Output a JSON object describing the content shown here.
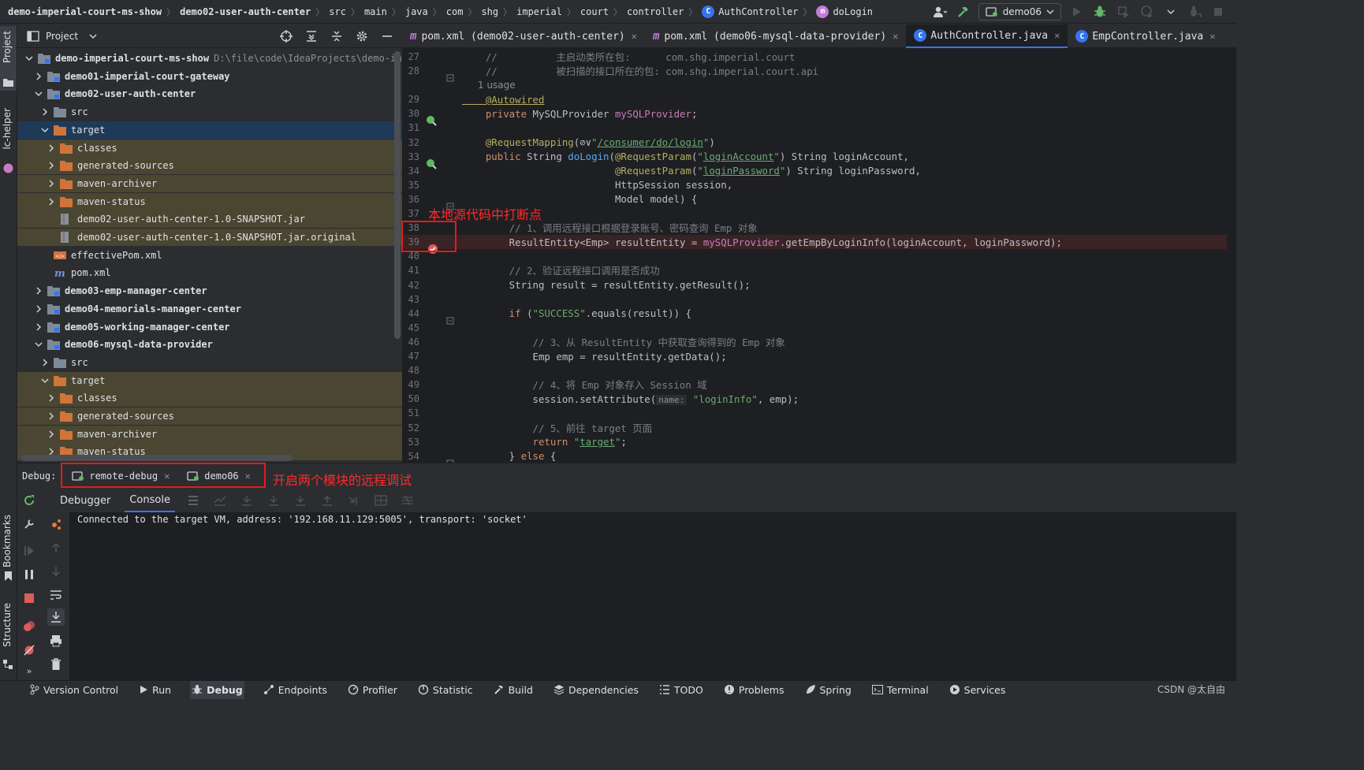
{
  "breadcrumbs": [
    "demo-imperial-court-ms-show",
    "demo02-user-auth-center",
    "src",
    "main",
    "java",
    "com",
    "shg",
    "imperial",
    "court",
    "controller",
    "AuthController",
    "doLogin"
  ],
  "toolbar": {
    "run_config": "demo06"
  },
  "left_stripe": {
    "project": "Project",
    "lc_helper": "lc-helper",
    "bookmarks": "Bookmarks",
    "structure": "Structure"
  },
  "project_panel": {
    "title": "Project",
    "rows": [
      {
        "indent": 0,
        "expanded": true,
        "icon": "module",
        "label": "demo-imperial-court-ms-show",
        "hint": "D:\\file\\code\\IdeaProjects\\demo-im",
        "bold": true,
        "style": ""
      },
      {
        "indent": 1,
        "expanded": false,
        "icon": "module",
        "label": "demo01-imperial-court-gateway",
        "hint": "",
        "bold": true,
        "style": ""
      },
      {
        "indent": 1,
        "expanded": true,
        "icon": "module",
        "label": "demo02-user-auth-center",
        "hint": "",
        "bold": true,
        "style": ""
      },
      {
        "indent": 2,
        "expanded": false,
        "icon": "folder",
        "label": "src",
        "hint": "",
        "bold": false,
        "style": ""
      },
      {
        "indent": 2,
        "expanded": true,
        "icon": "folder-orange",
        "label": "target",
        "hint": "",
        "bold": false,
        "style": "selected"
      },
      {
        "indent": 3,
        "expanded": false,
        "icon": "folder-orange",
        "label": "classes",
        "hint": "",
        "bold": false,
        "style": "excluded"
      },
      {
        "indent": 3,
        "expanded": false,
        "icon": "folder-orange",
        "label": "generated-sources",
        "hint": "",
        "bold": false,
        "style": "excluded"
      },
      {
        "indent": 3,
        "expanded": false,
        "icon": "folder-orange",
        "label": "maven-archiver",
        "hint": "",
        "bold": false,
        "style": "excluded"
      },
      {
        "indent": 3,
        "expanded": false,
        "icon": "folder-orange",
        "label": "maven-status",
        "hint": "",
        "bold": false,
        "style": "excluded"
      },
      {
        "indent": 3,
        "expanded": null,
        "icon": "jar",
        "label": "demo02-user-auth-center-1.0-SNAPSHOT.jar",
        "hint": "",
        "bold": false,
        "style": "excluded"
      },
      {
        "indent": 3,
        "expanded": null,
        "icon": "jar",
        "label": "demo02-user-auth-center-1.0-SNAPSHOT.jar.original",
        "hint": "",
        "bold": false,
        "style": "excluded"
      },
      {
        "indent": 2,
        "expanded": null,
        "icon": "xml",
        "label": "effectivePom.xml",
        "hint": "",
        "bold": false,
        "style": ""
      },
      {
        "indent": 2,
        "expanded": null,
        "icon": "maven",
        "label": "pom.xml",
        "hint": "",
        "bold": false,
        "style": ""
      },
      {
        "indent": 1,
        "expanded": false,
        "icon": "module",
        "label": "demo03-emp-manager-center",
        "hint": "",
        "bold": true,
        "style": ""
      },
      {
        "indent": 1,
        "expanded": false,
        "icon": "module",
        "label": "demo04-memorials-manager-center",
        "hint": "",
        "bold": true,
        "style": ""
      },
      {
        "indent": 1,
        "expanded": false,
        "icon": "module",
        "label": "demo05-working-manager-center",
        "hint": "",
        "bold": true,
        "style": ""
      },
      {
        "indent": 1,
        "expanded": true,
        "icon": "module",
        "label": "demo06-mysql-data-provider",
        "hint": "",
        "bold": true,
        "style": ""
      },
      {
        "indent": 2,
        "expanded": false,
        "icon": "folder",
        "label": "src",
        "hint": "",
        "bold": false,
        "style": ""
      },
      {
        "indent": 2,
        "expanded": true,
        "icon": "folder-orange",
        "label": "target",
        "hint": "",
        "bold": false,
        "style": "excluded"
      },
      {
        "indent": 3,
        "expanded": false,
        "icon": "folder-orange",
        "label": "classes",
        "hint": "",
        "bold": false,
        "style": "excluded"
      },
      {
        "indent": 3,
        "expanded": false,
        "icon": "folder-orange",
        "label": "generated-sources",
        "hint": "",
        "bold": false,
        "style": "excluded"
      },
      {
        "indent": 3,
        "expanded": false,
        "icon": "folder-orange",
        "label": "maven-archiver",
        "hint": "",
        "bold": false,
        "style": "excluded"
      },
      {
        "indent": 3,
        "expanded": false,
        "icon": "folder-orange",
        "label": "maven-status",
        "hint": "",
        "bold": false,
        "style": "excluded"
      }
    ]
  },
  "editor": {
    "tabs": [
      {
        "kind": "maven",
        "label": "pom.xml (demo02-user-auth-center)",
        "active": false
      },
      {
        "kind": "maven",
        "label": "pom.xml (demo06-mysql-data-provider)",
        "active": false
      },
      {
        "kind": "class",
        "label": "AuthController.java",
        "active": true
      },
      {
        "kind": "class",
        "label": "EmpController.java",
        "active": false
      }
    ],
    "usage_hint": "1 usage",
    "lines": [
      {
        "n": "27",
        "parts": [
          [
            "cm",
            "    //          主启动类所在包:      com.shg.imperial.court"
          ]
        ]
      },
      {
        "n": "28",
        "parts": [
          [
            "cm",
            "    //          被扫描的接口所在的包: com.shg.imperial.court.api"
          ]
        ]
      },
      {
        "n": "29",
        "parts": [
          [
            "an ul",
            "    @Autowired"
          ]
        ]
      },
      {
        "n": "30",
        "parts": [
          [
            "kw",
            "    private "
          ],
          [
            "cn",
            "MySQLProvider "
          ],
          [
            "fld",
            "mySQLProvider"
          ],
          [
            "cn",
            ";"
          ]
        ]
      },
      {
        "n": "31",
        "parts": []
      },
      {
        "n": "32",
        "parts": [
          [
            "an",
            "    @RequestMapping"
          ],
          [
            "cn",
            "(⊘∨"
          ],
          [
            "st",
            "\""
          ],
          [
            "st ul",
            "/consumer/do/login"
          ],
          [
            "st",
            "\""
          ],
          [
            "cn",
            ")"
          ]
        ]
      },
      {
        "n": "33",
        "parts": [
          [
            "kw",
            "    public "
          ],
          [
            "cn",
            "String "
          ],
          [
            "fn",
            "doLogin"
          ],
          [
            "cn",
            "("
          ],
          [
            "an",
            "@RequestParam"
          ],
          [
            "cn",
            "("
          ],
          [
            "st",
            "\""
          ],
          [
            "st ul",
            "loginAccount"
          ],
          [
            "st",
            "\""
          ],
          [
            "cn",
            ") String loginAccount,"
          ]
        ]
      },
      {
        "n": "34",
        "parts": [
          [
            "cn",
            "                          "
          ],
          [
            "an",
            "@RequestParam"
          ],
          [
            "cn",
            "("
          ],
          [
            "st",
            "\""
          ],
          [
            "st ul",
            "loginPassword"
          ],
          [
            "st",
            "\""
          ],
          [
            "cn",
            ") String loginPassword,"
          ]
        ]
      },
      {
        "n": "35",
        "parts": [
          [
            "cn",
            "                          HttpSession session,"
          ]
        ]
      },
      {
        "n": "36",
        "parts": [
          [
            "cn",
            "                          Model model) {"
          ]
        ]
      },
      {
        "n": "37",
        "parts": []
      },
      {
        "n": "38",
        "parts": [
          [
            "cm",
            "        // 1、调用远程接口根据登录账号、密码查询 Emp 对象"
          ]
        ]
      },
      {
        "n": "39",
        "parts": [
          [
            "cn",
            "        ResultEntity<Emp> resultEntity = "
          ],
          [
            "fld",
            "mySQLProvider"
          ],
          [
            "cn",
            ".getEmpByLoginInfo(loginAccount, loginPassword);"
          ]
        ]
      },
      {
        "n": "40",
        "parts": []
      },
      {
        "n": "41",
        "parts": [
          [
            "cm",
            "        // 2、验证远程接口调用是否成功"
          ]
        ]
      },
      {
        "n": "42",
        "parts": [
          [
            "cn",
            "        String result = resultEntity.getResult();"
          ]
        ]
      },
      {
        "n": "43",
        "parts": []
      },
      {
        "n": "44",
        "parts": [
          [
            "kw",
            "        if "
          ],
          [
            "cn",
            "("
          ],
          [
            "st",
            "\"SUCCESS\""
          ],
          [
            "cn",
            ".equals(result)) {"
          ]
        ]
      },
      {
        "n": "45",
        "parts": []
      },
      {
        "n": "46",
        "parts": [
          [
            "cm",
            "            // 3、从 ResultEntity 中获取查询得到的 Emp 对象"
          ]
        ]
      },
      {
        "n": "47",
        "parts": [
          [
            "cn",
            "            Emp emp = resultEntity.getData();"
          ]
        ]
      },
      {
        "n": "48",
        "parts": []
      },
      {
        "n": "49",
        "parts": [
          [
            "cm",
            "            // 4、将 Emp 对象存入 Session 域"
          ]
        ]
      },
      {
        "n": "50",
        "parts": [
          [
            "cn",
            "            session.setAttribute("
          ],
          [
            "ph",
            "name:"
          ],
          [
            "st",
            " \"loginInfo\""
          ],
          [
            "cn",
            ", emp);"
          ]
        ]
      },
      {
        "n": "51",
        "parts": []
      },
      {
        "n": "52",
        "parts": [
          [
            "cm",
            "            // 5、前往 target 页面"
          ]
        ]
      },
      {
        "n": "53",
        "parts": [
          [
            "kw",
            "            return "
          ],
          [
            "st",
            "\""
          ],
          [
            "st ul",
            "target"
          ],
          [
            "st",
            "\""
          ],
          [
            "cn",
            ";"
          ]
        ]
      },
      {
        "n": "54",
        "parts": [
          [
            "cn",
            "        } "
          ],
          [
            "kw",
            "else "
          ],
          [
            "cn",
            "{"
          ]
        ]
      }
    ]
  },
  "annotations": {
    "breakpoint_note": "本地源代码中打断点",
    "debug_note": "开启两个模块的远程调试"
  },
  "debug": {
    "label": "Debug:",
    "sessions": [
      "remote-debug",
      "demo06"
    ],
    "subtabs": [
      "Debugger",
      "Console"
    ],
    "console": "Connected to the target VM, address: '192.168.11.129:5005', transport: 'socket'"
  },
  "statusbar": {
    "items": [
      {
        "icon": "vcs-icon",
        "label": "Version Control"
      },
      {
        "icon": "run-icon",
        "label": "Run"
      },
      {
        "icon": "debug-icon",
        "label": "Debug"
      },
      {
        "icon": "endpoints-icon",
        "label": "Endpoints"
      },
      {
        "icon": "profiler-icon",
        "label": "Profiler"
      },
      {
        "icon": "statistic-icon",
        "label": "Statistic"
      },
      {
        "icon": "build-icon",
        "label": "Build"
      },
      {
        "icon": "dependencies-icon",
        "label": "Dependencies"
      },
      {
        "icon": "todo-icon",
        "label": "TODO"
      },
      {
        "icon": "problems-icon",
        "label": "Problems"
      },
      {
        "icon": "spring-icon",
        "label": "Spring"
      },
      {
        "icon": "terminal-icon",
        "label": "Terminal"
      },
      {
        "icon": "services-icon",
        "label": "Services"
      }
    ],
    "active": "Debug",
    "watermark": "CSDN @太自由"
  },
  "colors": {
    "accent": "#3574f0",
    "annotation_red": "#e31b1b",
    "excluded_bg": "#4a4632"
  }
}
